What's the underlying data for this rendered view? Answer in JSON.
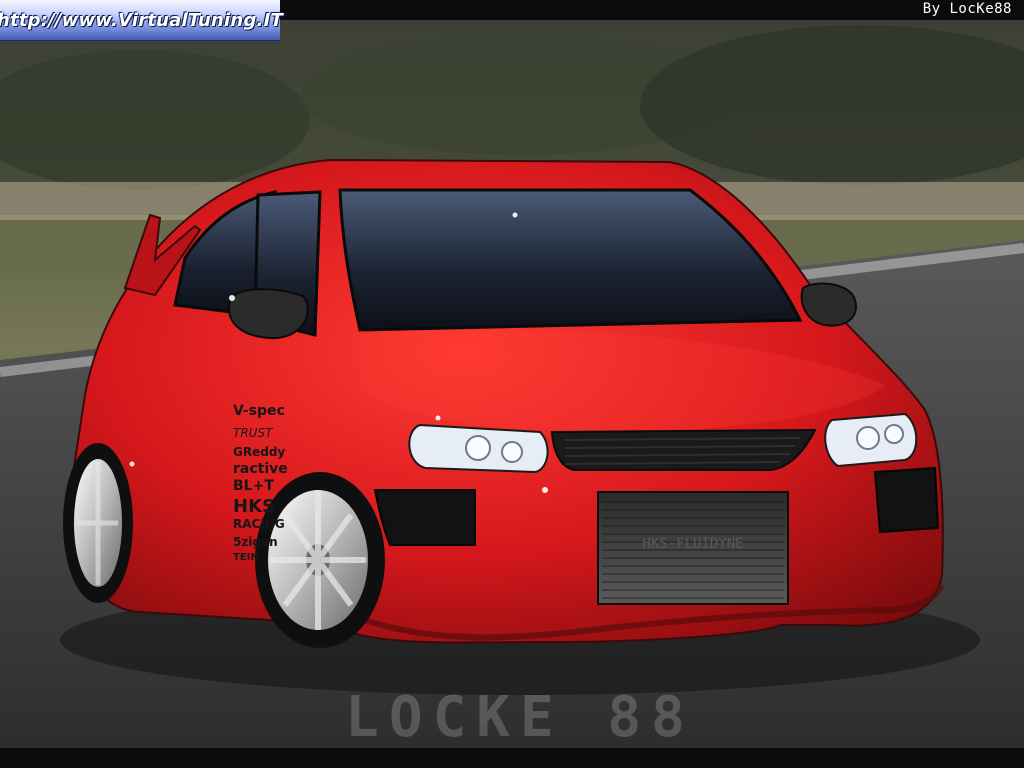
{
  "watermark_top_left": "http://www.VirtualTuning.IT",
  "credit_top_right": "By LocKe88",
  "road_signature": "LOCKE 88",
  "car_decals": [
    "V-spec",
    "TRUST",
    "GReddy",
    "ractive",
    "BL+T",
    "HKS",
    "RACING",
    "5zigen",
    "TEIN"
  ],
  "intercooler_text": "HKS-FLUIDYNE",
  "colors": {
    "car_red": "#d6181c",
    "road": "#3a3a3a",
    "grass": "#6d7150"
  }
}
